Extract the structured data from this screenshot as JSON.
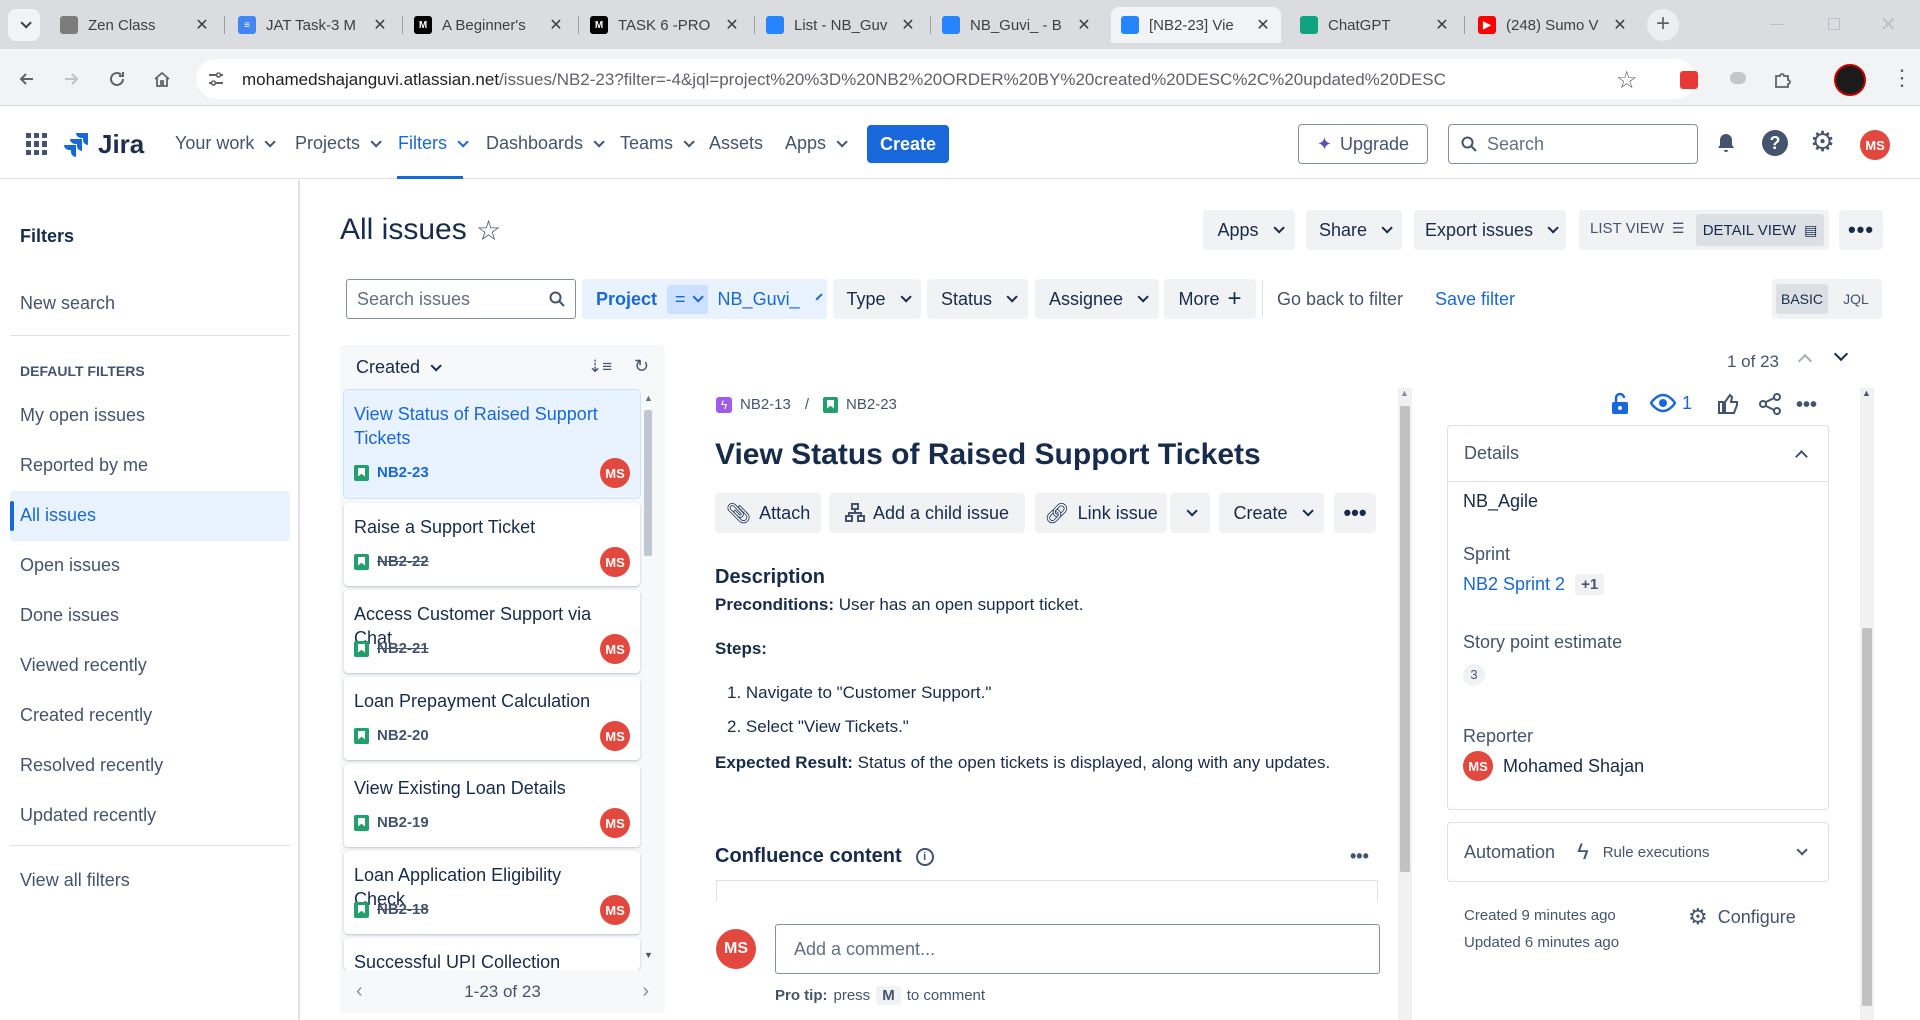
{
  "browser": {
    "tabs": [
      {
        "title": "Zen Class",
        "fav": "#7c7c7c",
        "g": ""
      },
      {
        "title": "JAT Task-3 M",
        "fav": "#4285f4",
        "g": "≡"
      },
      {
        "title": "A Beginner's",
        "fav": "#000000",
        "g": "M"
      },
      {
        "title": "TASK 6 -PRO",
        "fav": "#000000",
        "g": "M"
      },
      {
        "title": "List - NB_Guv",
        "fav": "#2684ff",
        "g": ""
      },
      {
        "title": "NB_Guvi_ - B",
        "fav": "#2684ff",
        "g": ""
      },
      {
        "title": "[NB2-23] Vie",
        "fav": "#2684ff",
        "g": ""
      },
      {
        "title": "ChatGPT",
        "fav": "#10a37f",
        "g": ""
      },
      {
        "title": "(248) Sumo V",
        "fav": "#ff0000",
        "g": "▶"
      }
    ],
    "url_host": "mohamedshajanguvi.atlassian.net",
    "url_rest": "/issues/NB2-23?filter=-4&jql=project%20%3D%20NB2%20ORDER%20BY%20created%20DESC%2C%20updated%20DESC"
  },
  "header": {
    "logo": "Jira",
    "nav": [
      "Your work",
      "Projects",
      "Filters",
      "Dashboards",
      "Teams",
      "Assets",
      "Apps"
    ],
    "create": "Create",
    "upgrade": "Upgrade",
    "search_placeholder": "Search",
    "avatar": "MS"
  },
  "sidebar": {
    "title": "Filters",
    "new_search": "New search",
    "section": "DEFAULT FILTERS",
    "items": [
      "My open issues",
      "Reported by me",
      "All issues",
      "Open issues",
      "Done issues",
      "Viewed recently",
      "Created recently",
      "Resolved recently",
      "Updated recently"
    ],
    "view_all": "View all filters"
  },
  "page": {
    "title": "All issues",
    "apps": "Apps",
    "share": "Share",
    "export": "Export issues",
    "list_view": "LIST VIEW",
    "detail_view": "DETAIL VIEW"
  },
  "filters": {
    "search_placeholder": "Search issues",
    "project_label": "Project",
    "project_op": "=",
    "project_value": "NB_Guvi_",
    "type": "Type",
    "status": "Status",
    "assignee": "Assignee",
    "more": "More",
    "go_back": "Go back to filter",
    "save": "Save filter",
    "basic": "BASIC",
    "jql": "JQL"
  },
  "list": {
    "sort": "Created",
    "cards": [
      {
        "title": "View Status of Raised Support Tickets",
        "key": "NB2-23",
        "done": false
      },
      {
        "title": "Raise a Support Ticket",
        "key": "NB2-22",
        "done": true
      },
      {
        "title": "Access Customer Support via Chat",
        "key": "NB2-21",
        "done": true
      },
      {
        "title": "Loan Prepayment Calculation",
        "key": "NB2-20",
        "done": false
      },
      {
        "title": "View Existing Loan Details",
        "key": "NB2-19",
        "done": false
      },
      {
        "title": "Loan Application Eligibility Check",
        "key": "NB2-18",
        "done": true
      },
      {
        "title": "Successful UPI Collection Request",
        "key": "",
        "done": false
      }
    ],
    "pagination": "1-23 of 23"
  },
  "issue": {
    "counter": "1 of 23",
    "parent_key": "NB2-13",
    "key": "NB2-23",
    "title": "View Status of Raised Support Tickets",
    "actions": {
      "attach": "Attach",
      "child": "Add a child issue",
      "link": "Link issue",
      "create": "Create"
    },
    "description_heading": "Description",
    "preconditions_label": "Preconditions:",
    "preconditions": "User has an open support ticket.",
    "steps_label": "Steps:",
    "steps": [
      "Navigate to \"Customer Support.\"",
      "Select \"View Tickets.\""
    ],
    "expected_label": "Expected Result:",
    "expected": "Status of the open tickets is displayed, along with any updates.",
    "confluence": "Confluence content",
    "comment_placeholder": "Add a comment...",
    "protip_label": "Pro tip:",
    "protip_pre": "press",
    "protip_key": "M",
    "protip_post": "to comment",
    "watchers": "1"
  },
  "details": {
    "heading": "Details",
    "team": "NB_Agile",
    "sprint_label": "Sprint",
    "sprint": "NB2 Sprint 2",
    "sprint_more": "+1",
    "sp_label": "Story point estimate",
    "sp": "3",
    "reporter_label": "Reporter",
    "reporter": "Mohamed Shajan",
    "automation": "Automation",
    "rule": "Rule executions",
    "created": "Created 9 minutes ago",
    "updated": "Updated 6 minutes ago",
    "configure": "Configure"
  }
}
